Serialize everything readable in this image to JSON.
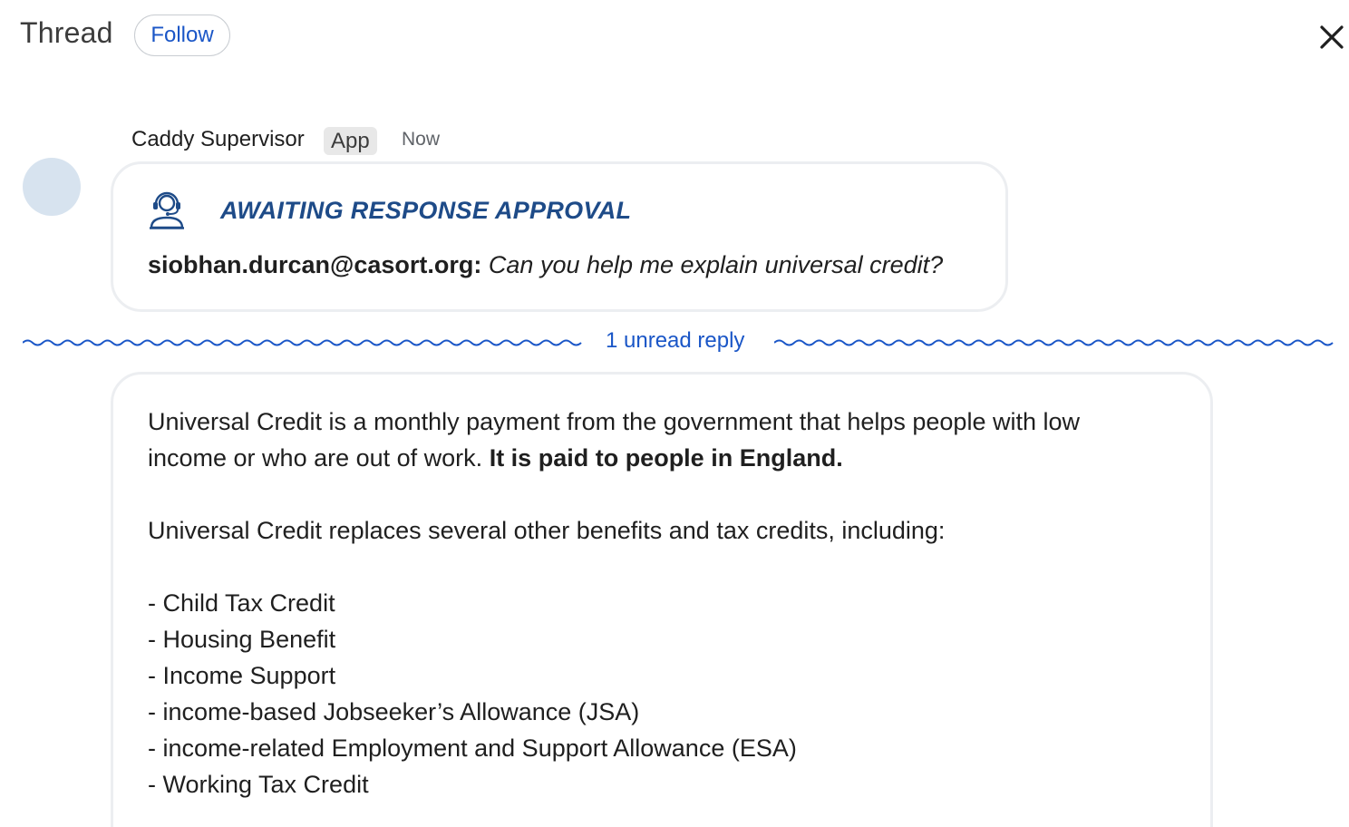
{
  "header": {
    "title": "Thread",
    "follow_label": "Follow"
  },
  "message": {
    "sender": "Caddy Supervisor",
    "badge": "App",
    "time": "Now",
    "card": {
      "title": "AWAITING RESPONSE APPROVAL",
      "email": "siobhan.durcan@casort.org:",
      "question": "Can you help me explain universal credit?"
    }
  },
  "divider": {
    "label": "1 unread reply"
  },
  "reply": {
    "para1_start": "Universal Credit is a monthly payment from the government that helps people with low income or who are out of work.",
    "para1_bold": "It is paid to people in England.",
    "para2": "Universal Credit replaces several other benefits and tax credits, including:",
    "list": [
      "- Child Tax Credit",
      "- Housing Benefit",
      "- Income Support",
      "- income-based Jobseeker’s Allowance (JSA)",
      "- income-related Employment and Support Allowance (ESA)",
      "- Working Tax Credit"
    ]
  },
  "colors": {
    "accent_blue": "#1a56c7",
    "title_blue": "#1e4b88",
    "avatar": "#d7e3ef"
  },
  "icons": {
    "close": "close-icon",
    "agent": "support-agent-icon"
  }
}
